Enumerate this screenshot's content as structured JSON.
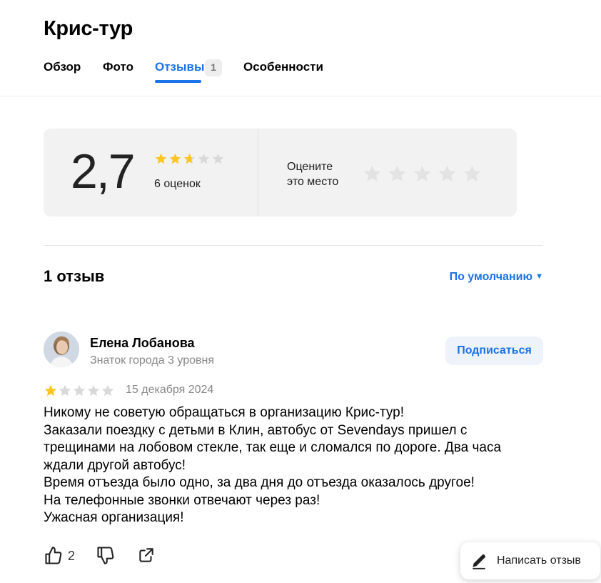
{
  "organization": {
    "title": "Крис-тур"
  },
  "tabs": [
    {
      "label": "Обзор"
    },
    {
      "label": "Фото"
    },
    {
      "label": "Отзывы",
      "count": "1",
      "active": true
    },
    {
      "label": "Особенности"
    }
  ],
  "rating": {
    "value": "2,7",
    "stars_value": 2.7,
    "count_label": "6 оценок",
    "rate_prompt_line1": "Оцените",
    "rate_prompt_line2": "это место"
  },
  "reviews": {
    "count_label": "1 отзыв",
    "sort_label": "По умолчанию"
  },
  "review": {
    "author": "Елена Лобанова",
    "level": "Знаток города 3 уровня",
    "subscribe_label": "Подписаться",
    "stars": 1,
    "date": "15 декабря 2024",
    "text_lines": [
      "Никому не советую обращаться в организацию Крис-тур!",
      "Заказали поездку с детьми в Клин, автобус от Sevendays пришел с",
      "трещинами на лобовом стекле, так еще и сломался по дороге. Два часа",
      "ждали другой автобус!",
      "Время отъезда было одно, за два дня до отъезда оказалось другое!",
      "На телефонные звонки отвечают через раз!",
      "Ужасная организация!"
    ],
    "likes": "2"
  },
  "write_review_label": "Написать отзыв",
  "icons": {
    "like": "thumbs-up-icon",
    "dislike": "thumbs-down-icon",
    "share": "share-icon",
    "pen": "pen-icon",
    "star": "star-icon"
  },
  "colors": {
    "accent": "#1a73e8",
    "star_filled": "#fcc521",
    "star_empty": "#d9d9d9",
    "card_bg": "#f2f2f2"
  }
}
